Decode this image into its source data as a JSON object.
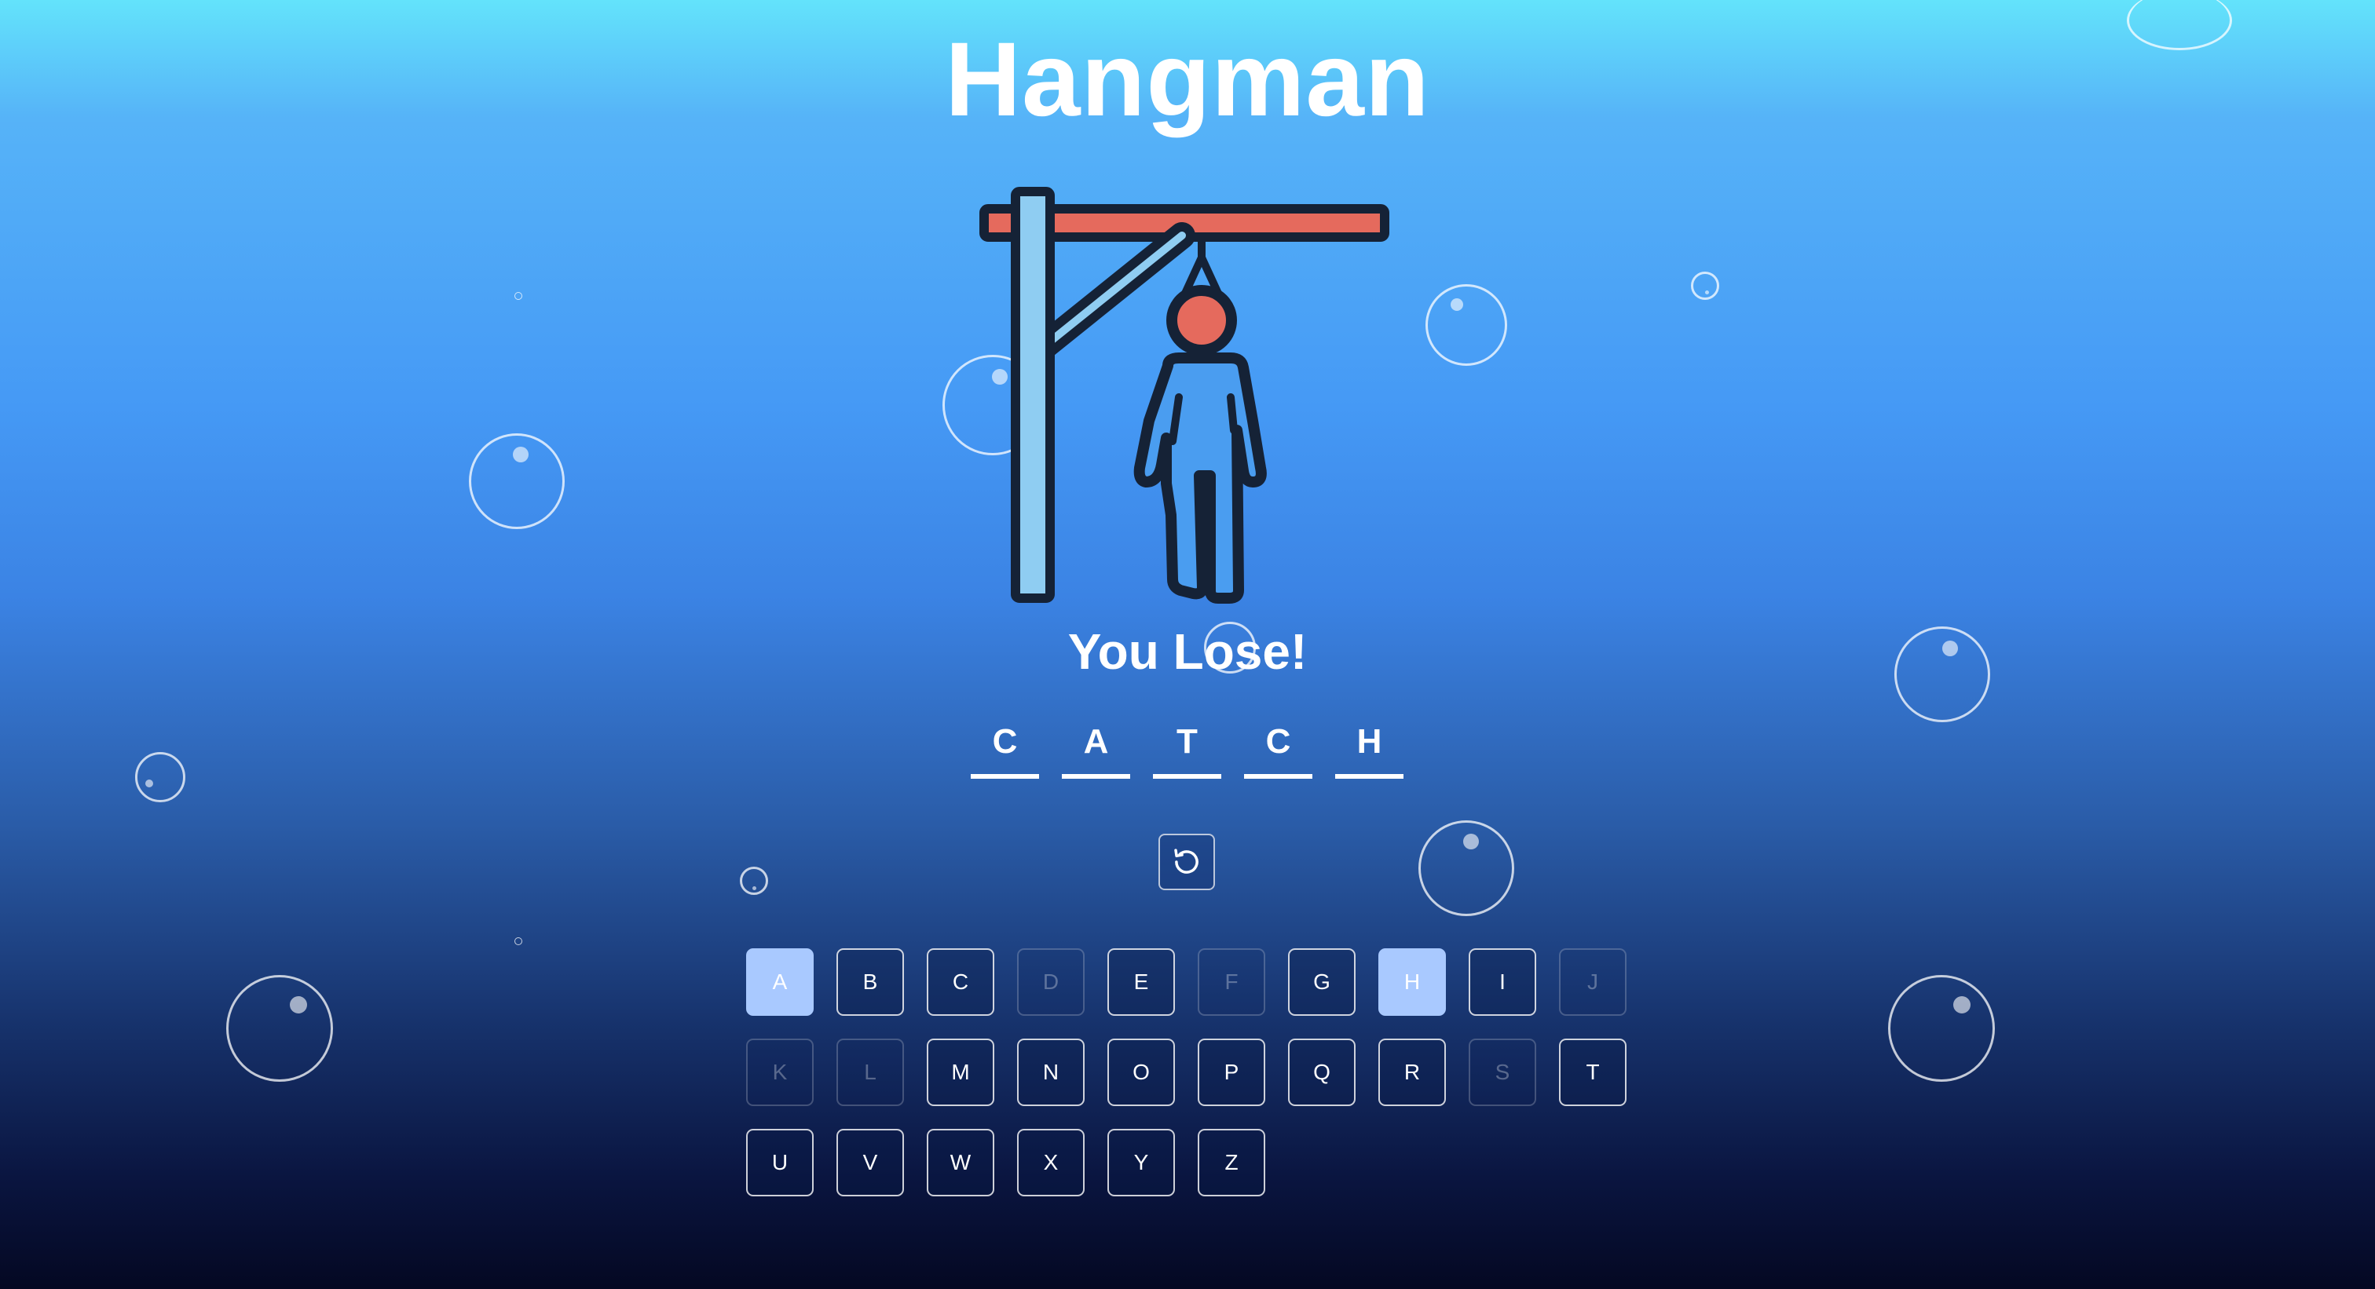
{
  "game": {
    "title": "Hangman",
    "status": "You Lose!",
    "word": [
      "C",
      "A",
      "T",
      "C",
      "H"
    ],
    "reset_icon": "restart-icon"
  },
  "keyboard": [
    {
      "letter": "A",
      "state": "correct"
    },
    {
      "letter": "B",
      "state": "unused"
    },
    {
      "letter": "C",
      "state": "unused"
    },
    {
      "letter": "D",
      "state": "wrong"
    },
    {
      "letter": "E",
      "state": "unused"
    },
    {
      "letter": "F",
      "state": "wrong"
    },
    {
      "letter": "G",
      "state": "unused"
    },
    {
      "letter": "H",
      "state": "correct"
    },
    {
      "letter": "I",
      "state": "unused"
    },
    {
      "letter": "J",
      "state": "wrong"
    },
    {
      "letter": "K",
      "state": "wrong"
    },
    {
      "letter": "L",
      "state": "wrong"
    },
    {
      "letter": "M",
      "state": "unused"
    },
    {
      "letter": "N",
      "state": "unused"
    },
    {
      "letter": "O",
      "state": "unused"
    },
    {
      "letter": "P",
      "state": "unused"
    },
    {
      "letter": "Q",
      "state": "unused"
    },
    {
      "letter": "R",
      "state": "unused"
    },
    {
      "letter": "S",
      "state": "wrong"
    },
    {
      "letter": "T",
      "state": "unused"
    },
    {
      "letter": "U",
      "state": "unused"
    },
    {
      "letter": "V",
      "state": "unused"
    },
    {
      "letter": "W",
      "state": "unused"
    },
    {
      "letter": "X",
      "state": "unused"
    },
    {
      "letter": "Y",
      "state": "unused"
    },
    {
      "letter": "Z",
      "state": "unused"
    }
  ],
  "colors": {
    "beam": "#e56a5d",
    "head": "#e56a5d",
    "post": "#8fcdf2",
    "body": "#4a9df0",
    "outline": "#152236",
    "correct_key": "#a9c9ff"
  }
}
